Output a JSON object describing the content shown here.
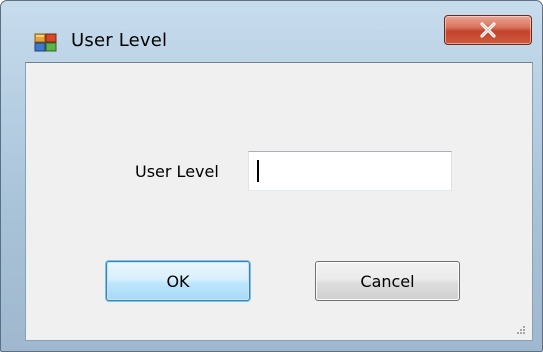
{
  "window": {
    "title": "User Level",
    "icon": "app-form-icon",
    "close_icon": "close-icon"
  },
  "form": {
    "user_level_label": "User Level",
    "user_level_value": "",
    "user_level_placeholder": ""
  },
  "buttons": {
    "ok_label": "OK",
    "cancel_label": "Cancel"
  },
  "colors": {
    "close_button": "#c2432c",
    "default_button_border": "#3c7fb1",
    "client_background": "#f0f0f0"
  }
}
